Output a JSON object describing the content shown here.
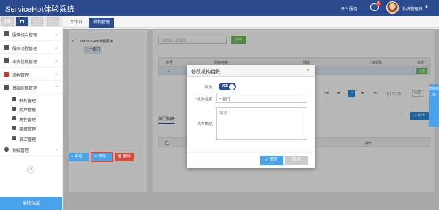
{
  "app": {
    "title": "ServiceHot体验系统"
  },
  "topbar": {
    "platform_service": "平台服务",
    "message_count": "1",
    "user_name": "系统管理员",
    "user_caret": "▼"
  },
  "sidebar": {
    "items": [
      {
        "label": "服务组合管理"
      },
      {
        "label": "服务流程管理"
      },
      {
        "label": "业务信息管理"
      },
      {
        "label": "流程管理"
      },
      {
        "label": "基础信息管理"
      }
    ],
    "subitems": [
      {
        "label": "机构管理"
      },
      {
        "label": "用户管理"
      },
      {
        "label": "角色管理"
      },
      {
        "label": "菜单管理"
      },
      {
        "label": "员工管理"
      }
    ],
    "system_item": {
      "label": "系统管理"
    },
    "collapse": "«",
    "footer": "系统体验"
  },
  "tabs": [
    {
      "label": "工作台"
    },
    {
      "label": "机构管理"
    }
  ],
  "tree": {
    "root": "ServiceHot体验系统",
    "child": "**部门"
  },
  "toolbar": {
    "add": "+ 新增",
    "edit": "✎ 修改",
    "delete": "🗑 删除"
  },
  "search": {
    "placeholder": "此需输入关键词",
    "button": "搜索"
  },
  "grid": {
    "headers": [
      "序号",
      "机构名称",
      "描述",
      "上级机构",
      "状态"
    ],
    "row": {
      "index": "1",
      "status": "启用"
    }
  },
  "pager": {
    "page": "1",
    "total": "1/1共1条",
    "size": "5/页"
  },
  "dept_tab": {
    "label": "部门列表",
    "add": "+ 新增",
    "ops": "操作"
  },
  "modal": {
    "title": "修改机构组织",
    "close": "×",
    "status_label": "状态:",
    "toggle_text": "YES",
    "name_label": "*机构名称:",
    "name_value": "**部门",
    "desc_label": "机构描述:",
    "desc_placeholder": "描述",
    "save": "✓ 保存",
    "cancel": "取消"
  },
  "float_tab": {
    "label": "帮助信息"
  },
  "colors": {
    "primary": "#2b4b8e",
    "accent": "#4aa3e8",
    "danger": "#d94a38",
    "success": "#6fbf5a"
  }
}
